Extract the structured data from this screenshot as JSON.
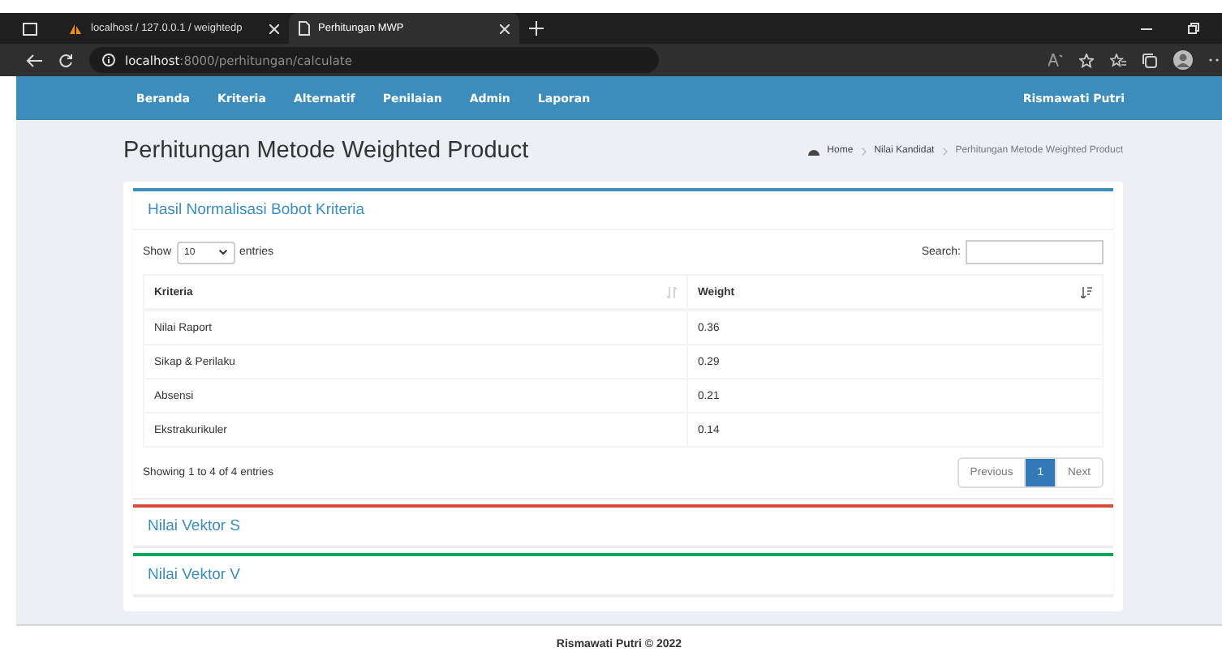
{
  "browser": {
    "tabs": [
      {
        "title": "localhost / 127.0.0.1 / weightedp",
        "kind": "db",
        "selected": false
      },
      {
        "title": "Perhitungan MWP",
        "kind": "page",
        "selected": true
      }
    ],
    "address": {
      "host": "localhost",
      "path": ":8000/perhitungan/calculate"
    }
  },
  "navbar": {
    "items": [
      "Beranda",
      "Kriteria",
      "Alternatif",
      "Penilaian",
      "Admin",
      "Laporan"
    ],
    "user": "Rismawati Putri"
  },
  "page": {
    "title": "Perhitungan Metode Weighted Product",
    "breadcrumb": [
      {
        "label": "Home",
        "kind": "home"
      },
      {
        "label": "Nilai Kandidat",
        "kind": "link"
      },
      {
        "label": "Perhitungan Metode Weighted Product",
        "kind": "current"
      }
    ]
  },
  "boxes": [
    {
      "title": "Hasil Normalisasi Bobot Kriteria",
      "color": "#3c8dbc",
      "kind": "table"
    },
    {
      "title": "Nilai Vektor S",
      "color": "#dd4b39",
      "kind": "collapsed"
    },
    {
      "title": "Nilai Vektor V",
      "color": "#00a65a",
      "kind": "collapsed"
    }
  ],
  "table": {
    "show_label": "Show",
    "page_length": "10",
    "entries_label": "entries",
    "search_label": "Search:",
    "columns": [
      {
        "label": "Kriteria",
        "sorted": false
      },
      {
        "label": "Weight",
        "sorted": true
      }
    ],
    "rows": [
      [
        "Nilai Raport",
        "0.36"
      ],
      [
        "Sikap & Perilaku",
        "0.29"
      ],
      [
        "Absensi",
        "0.21"
      ],
      [
        "Ekstrakurikuler",
        "0.14"
      ]
    ],
    "info": "Showing 1 to 4 of 4 entries",
    "pagination": [
      {
        "label": "Previous",
        "selected": false
      },
      {
        "label": "1",
        "selected": true
      },
      {
        "label": "Next",
        "selected": false
      }
    ]
  },
  "footer": "Rismawati Putri © 2022"
}
